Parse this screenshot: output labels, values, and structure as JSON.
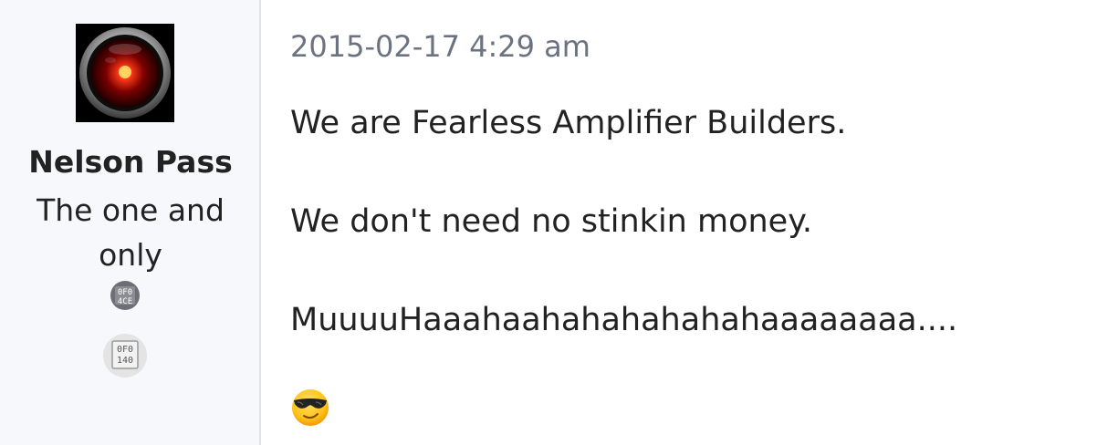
{
  "user": {
    "avatar_icon": "hal-9000-eye-icon",
    "name": "Nelson Pass",
    "title": "The one and only",
    "badges": [
      "rank-badge-icon",
      "rank-badge-alt-icon"
    ]
  },
  "post": {
    "timestamp": "2015-02-17 4:29 am",
    "paragraphs": [
      "We are Fearless Amplifier Builders.",
      "We don't need no stinkin money.",
      "MuuuuHaaahaahahahahahahaaaaaaaa...."
    ],
    "emoji_icon": "smiling-face-with-sunglasses-icon"
  },
  "colors": {
    "sidebar_bg": "#f6f8fb",
    "text": "#222222",
    "timestamp": "#6b7280"
  }
}
